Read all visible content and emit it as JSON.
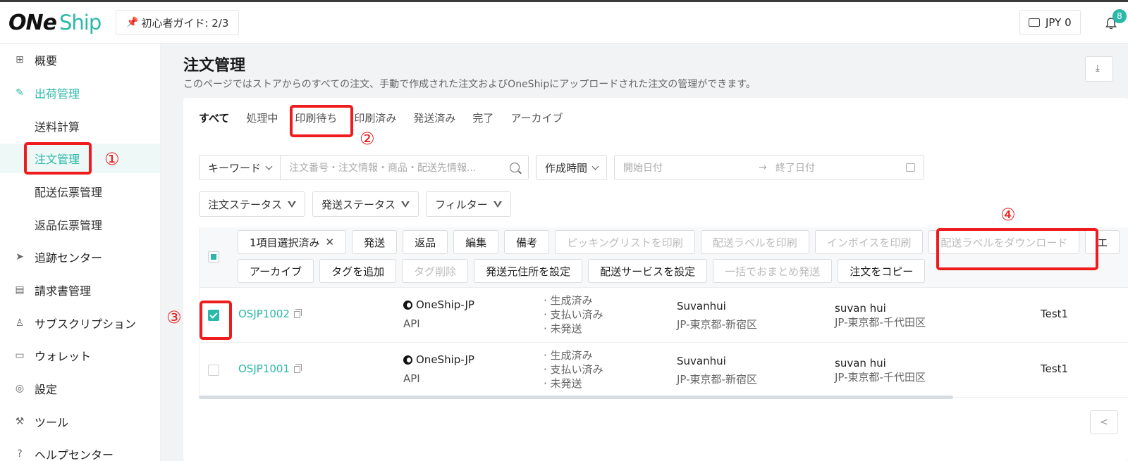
{
  "header": {
    "logo_one": "ONe",
    "logo_ship": "Ship",
    "guide_label": "初心者ガイド: 2/3",
    "wallet_label": "JPY 0",
    "notification_count": "8"
  },
  "sidebar": {
    "items": [
      {
        "label": "概要",
        "icon": "grid-icon"
      },
      {
        "label": "出荷管理",
        "icon": "shipping-icon"
      },
      {
        "label": "送料計算"
      },
      {
        "label": "注文管理"
      },
      {
        "label": "配送伝票管理"
      },
      {
        "label": "返品伝票管理"
      },
      {
        "label": "追跡センター",
        "icon": "send-icon"
      },
      {
        "label": "請求書管理",
        "icon": "document-icon"
      },
      {
        "label": "サブスクリプション",
        "icon": "user-icon"
      },
      {
        "label": "ウォレット",
        "icon": "wallet-icon"
      },
      {
        "label": "設定",
        "icon": "settings-icon"
      },
      {
        "label": "ツール",
        "icon": "tools-icon"
      },
      {
        "label": "ヘルプセンター",
        "icon": "help-icon"
      }
    ]
  },
  "main": {
    "title": "注文管理",
    "description": "このページではストアからのすべての注文、手動で作成された注文およびOneShipにアップロードされた注文の管理ができます。",
    "tabs": [
      "すべて",
      "処理中",
      "印刷待ち",
      "印刷済み",
      "発送済み",
      "完了",
      "アーカイブ"
    ],
    "filters": {
      "keyword_select": "キーワード",
      "search_placeholder": "注文番号・注文情報・商品・配送先情報...",
      "time_select": "作成時間",
      "date_start_placeholder": "開始日付",
      "date_end_placeholder": "終了日付",
      "order_status": "注文ステータス",
      "shipping_status": "発送ステータス",
      "filter": "フィルター"
    },
    "bulk_actions": {
      "selected": "1項目選択済み",
      "line1": [
        "発送",
        "返品",
        "編集",
        "備考",
        "ピッキングリストを印刷",
        "配送ラベルを印刷",
        "インボイスを印刷",
        "配送ラベルをダウンロード",
        "エ"
      ],
      "line2": [
        "アーカイブ",
        "タグを追加",
        "タグ削除",
        "発送元住所を設定",
        "配送サービスを設定",
        "一括でおまとめ発送",
        "注文をコピー"
      ]
    },
    "orders": [
      {
        "order_no": "OSJP1002",
        "checked": true,
        "store": "OneShip-JP",
        "store_type": "API",
        "statuses": [
          "· 生成済み",
          "· 支払い済み",
          "· 未発送"
        ],
        "sender_name": "Suvanhui",
        "sender_addr": "JP-東京都-新宿区",
        "recipient_name": "suvan hui",
        "recipient_addr": "JP-東京都-千代田区",
        "tag": "Test1"
      },
      {
        "order_no": "OSJP1001",
        "checked": false,
        "store": "OneShip-JP",
        "store_type": "API",
        "statuses": [
          "· 生成済み",
          "· 支払い済み",
          "· 未発送"
        ],
        "sender_name": "Suvanhui",
        "sender_addr": "JP-東京都-新宿区",
        "recipient_name": "suvan hui",
        "recipient_addr": "JP-東京都-千代田区",
        "tag": "Test1"
      }
    ],
    "pager_prev": "<"
  },
  "annotations": [
    "①",
    "②",
    "③",
    "④"
  ],
  "colors": {
    "accent": "#2bb8a8",
    "annotation": "#ee1c1c"
  }
}
